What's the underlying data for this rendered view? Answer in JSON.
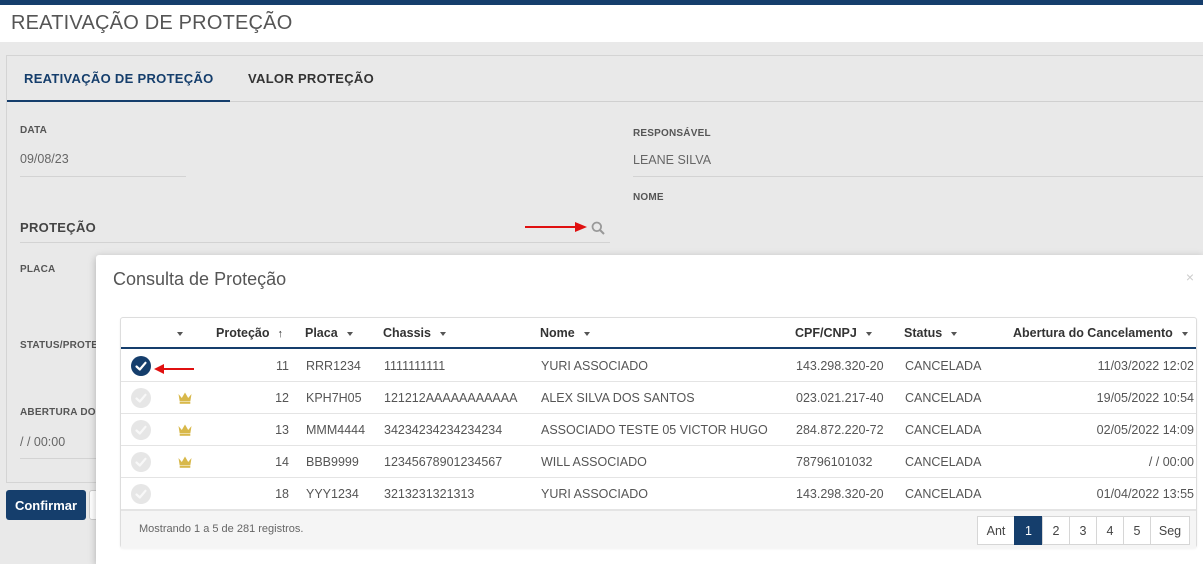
{
  "page": {
    "title": "REATIVAÇÃO DE PROTEÇÃO"
  },
  "tabs": [
    {
      "label": "REATIVAÇÃO DE PROTEÇÃO",
      "active": true
    },
    {
      "label": "VALOR PROTEÇÃO",
      "active": false
    }
  ],
  "form": {
    "data_label": "DATA",
    "data_value": "09/08/23",
    "responsavel_label": "RESPONSÁVEL",
    "responsavel_value": "LEANE SILVA",
    "nome_label": "NOME",
    "section_title": "PROTEÇÃO",
    "placa_label": "PLACA",
    "status_label": "STATUS/PROTE",
    "abertura_label": "ABERTURA DO",
    "abertura_value": "/ / 00:00"
  },
  "buttons": {
    "confirm": "Confirmar"
  },
  "modal": {
    "title": "Consulta de Proteção",
    "close": "×",
    "columns": [
      "Proteção",
      "Placa",
      "Chassis",
      "Nome",
      "CPF/CNPJ",
      "Status",
      "Abertura do Cancelamento"
    ],
    "rows": [
      {
        "selected": true,
        "crown": false,
        "protecao": "11",
        "placa": "RRR1234",
        "chassis": "1111111111",
        "nome": "YURI ASSOCIADO",
        "cpf": "143.298.320-20",
        "status": "CANCELADA",
        "abertura": "11/03/2022 12:02"
      },
      {
        "selected": false,
        "crown": true,
        "protecao": "12",
        "placa": "KPH7H05",
        "chassis": "121212AAAAAAAAAAA",
        "nome": "ALEX SILVA DOS SANTOS",
        "cpf": "023.021.217-40",
        "status": "CANCELADA",
        "abertura": "19/05/2022 10:54"
      },
      {
        "selected": false,
        "crown": true,
        "protecao": "13",
        "placa": "MMM4444",
        "chassis": "34234234234234234",
        "nome": "ASSOCIADO TESTE 05 VICTOR HUGO",
        "cpf": "284.872.220-72",
        "status": "CANCELADA",
        "abertura": "02/05/2022 14:09"
      },
      {
        "selected": false,
        "crown": true,
        "protecao": "14",
        "placa": "BBB9999",
        "chassis": "12345678901234567",
        "nome": "WILL ASSOCIADO",
        "cpf": "78796101032",
        "status": "CANCELADA",
        "abertura": "/ / 00:00"
      },
      {
        "selected": false,
        "crown": false,
        "protecao": "18",
        "placa": "YYY1234",
        "chassis": "3213231321313",
        "nome": "YURI ASSOCIADO",
        "cpf": "143.298.320-20",
        "status": "CANCELADA",
        "abertura": "01/04/2022 13:55"
      }
    ],
    "footer": "Mostrando 1 a 5 de 281 registros.",
    "pager": {
      "prev": "Ant",
      "pages": [
        "1",
        "2",
        "3",
        "4",
        "5"
      ],
      "next": "Seg",
      "current": "1"
    }
  },
  "colors": {
    "primary": "#153e6c",
    "arrow": "#e01010",
    "crown": "#d8b84a"
  }
}
